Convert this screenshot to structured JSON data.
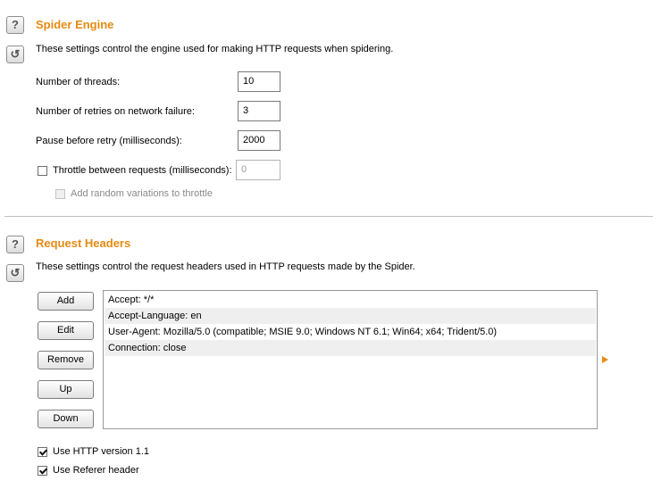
{
  "spider_engine": {
    "title": "Spider Engine",
    "description": "These settings control the engine used for making HTTP requests when spidering.",
    "threads_label": "Number of threads:",
    "threads_value": "10",
    "retries_label": "Number of retries on network failure:",
    "retries_value": "3",
    "pause_label": "Pause before retry (milliseconds):",
    "pause_value": "2000",
    "throttle_label": "Throttle between requests (milliseconds):",
    "throttle_value": "0",
    "throttle_checked": false,
    "random_variations_label": "Add random variations to throttle",
    "random_variations_checked": false
  },
  "request_headers": {
    "title": "Request Headers",
    "description": "These settings control the request headers used in HTTP requests made by the Spider.",
    "buttons": {
      "add": "Add",
      "edit": "Edit",
      "remove": "Remove",
      "up": "Up",
      "down": "Down"
    },
    "headers": [
      "Accept: */*",
      "Accept-Language: en",
      "User-Agent: Mozilla/5.0 (compatible; MSIE 9.0; Windows NT 6.1; Win64; x64; Trident/5.0)",
      "Connection: close"
    ],
    "http11_label": "Use HTTP version 1.1",
    "http11_checked": true,
    "referer_label": "Use Referer header",
    "referer_checked": true
  },
  "icons": {
    "help": "?",
    "restore": "↺"
  },
  "colors": {
    "accent": "#e58a12"
  }
}
